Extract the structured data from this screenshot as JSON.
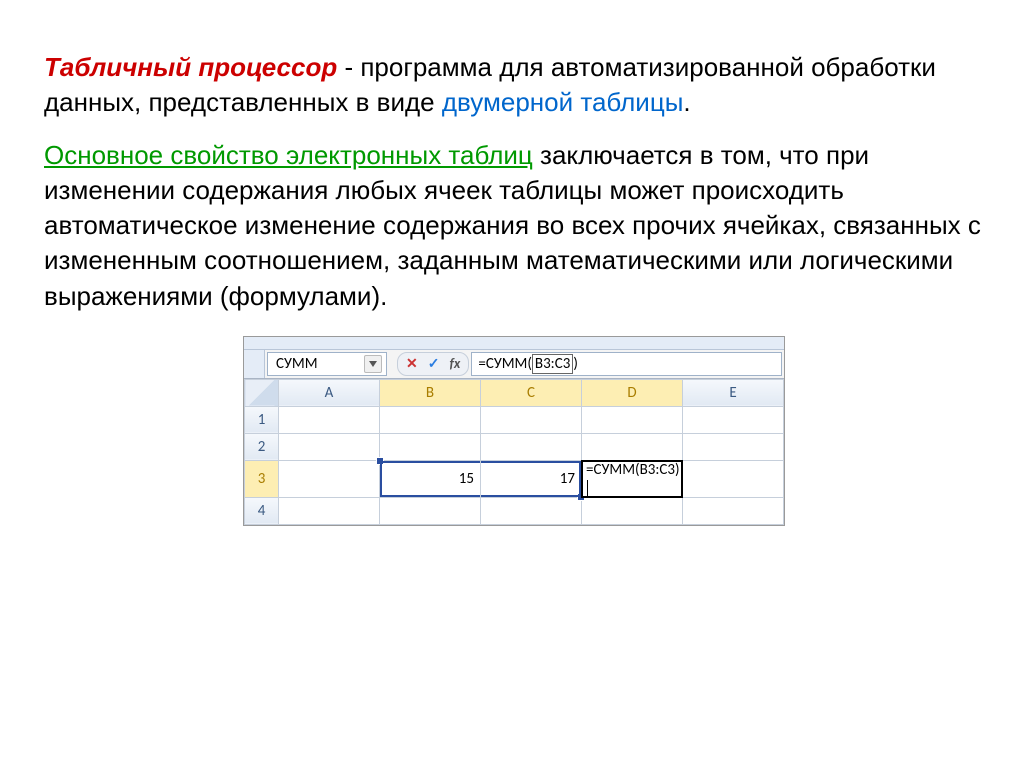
{
  "text": {
    "title_term": "Табличный процессор",
    "para1_rest": " - программа для автоматизированной обработки данных, представленных в виде ",
    "blue_term": "двумерной таблицы",
    "period": ".",
    "green_term": "Основное свойство электронных таблиц",
    "para2_rest": " заключается в том, что при изменении содержания любых ячеек таблицы может происходить автоматическое изменение содержания во всех прочих ячейках, связанных с измененным соотношением, заданным математическими или логическими выражениями (формулами)."
  },
  "excel": {
    "namebox": "СУММ",
    "fx_cancel": "✕",
    "fx_accept": "✓",
    "fx_label": "fx",
    "formula_prefix": "=СУММ(",
    "formula_arg": "B3:C3",
    "formula_suffix": ")",
    "columns": [
      "A",
      "B",
      "C",
      "D",
      "E"
    ],
    "rows": [
      "1",
      "2",
      "3",
      "4"
    ],
    "b3_value": "15",
    "c3_value": "17",
    "d3_value": "=СУММ(B3:C3)"
  }
}
